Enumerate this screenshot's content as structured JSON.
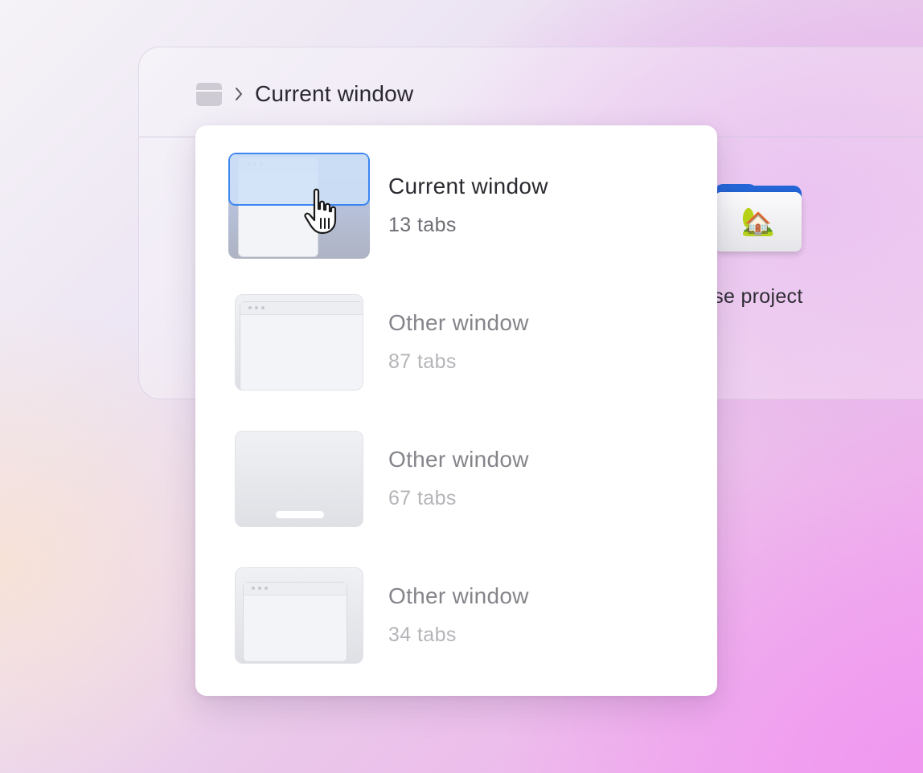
{
  "breadcrumb": {
    "icon": "window-icon",
    "separator_icon": "chevron-right-icon",
    "title": "Current window"
  },
  "background_folder": {
    "icon": "house-folder-icon",
    "label": "use project"
  },
  "menu": {
    "items": [
      {
        "title": "Current window",
        "subtitle": "13 tabs",
        "state": "selected"
      },
      {
        "title": "Other window",
        "subtitle": "87 tabs",
        "state": "normal"
      },
      {
        "title": "Other window",
        "subtitle": "67 tabs",
        "state": "normal"
      },
      {
        "title": "Other window",
        "subtitle": "34 tabs",
        "state": "normal"
      }
    ]
  },
  "colors": {
    "selection_border": "#3b86f0",
    "folder_blue": "#2466d8"
  }
}
